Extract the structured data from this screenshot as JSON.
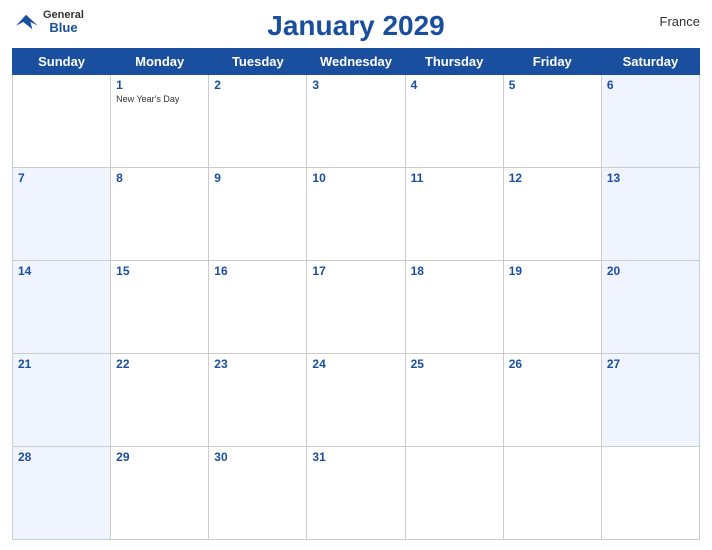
{
  "header": {
    "logo": {
      "general": "General",
      "blue": "Blue",
      "bird_unicode": "🔷"
    },
    "title": "January 2029",
    "country": "France"
  },
  "days_of_week": [
    "Sunday",
    "Monday",
    "Tuesday",
    "Wednesday",
    "Thursday",
    "Friday",
    "Saturday"
  ],
  "weeks": [
    [
      null,
      1,
      2,
      3,
      4,
      5,
      6
    ],
    [
      7,
      8,
      9,
      10,
      11,
      12,
      13
    ],
    [
      14,
      15,
      16,
      17,
      18,
      19,
      20
    ],
    [
      21,
      22,
      23,
      24,
      25,
      26,
      27
    ],
    [
      28,
      29,
      30,
      31,
      null,
      null,
      null
    ]
  ],
  "holidays": {
    "1": "New Year's Day"
  }
}
